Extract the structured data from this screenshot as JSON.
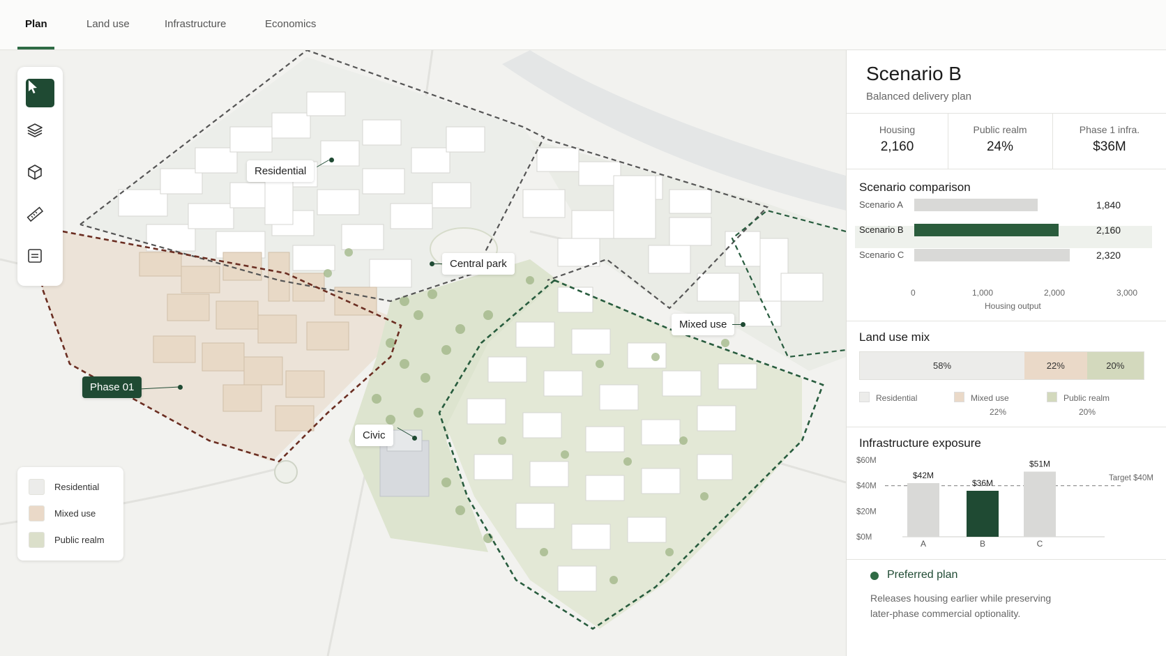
{
  "tabs": [
    {
      "label": "Plan",
      "active": true
    },
    {
      "label": "Land use",
      "active": false
    },
    {
      "label": "Infrastructure",
      "active": false
    },
    {
      "label": "Economics",
      "active": false
    }
  ],
  "toolbar": {
    "tools": [
      "pointer-icon",
      "layers-icon",
      "cube-icon",
      "ruler-icon",
      "list-icon"
    ]
  },
  "map": {
    "labels": {
      "residential": "Residential",
      "central_park": "Central park",
      "mixed_use": "Mixed use",
      "phase": "Phase 01",
      "civic": "Civic"
    },
    "legend": [
      {
        "label": "Residential",
        "color": "#ececea"
      },
      {
        "label": "Mixed use",
        "color": "#ead9c8"
      },
      {
        "label": "Public realm",
        "color": "#dbdfca"
      }
    ]
  },
  "panel": {
    "title": "Scenario B",
    "subtitle": "Balanced delivery plan",
    "kpis": [
      {
        "label": "Housing",
        "value": "2,160"
      },
      {
        "label": "Public realm",
        "value": "24%"
      },
      {
        "label": "Phase 1 infra.",
        "value": "$36M"
      }
    ],
    "comparison": {
      "title": "Scenario comparison",
      "rows": [
        {
          "label": "Scenario A",
          "value": 1840,
          "display": "1,840",
          "selected": false
        },
        {
          "label": "Scenario B",
          "value": 2160,
          "display": "2,160",
          "selected": true
        },
        {
          "label": "Scenario C",
          "value": 2320,
          "display": "2,320",
          "selected": false
        }
      ],
      "ticks": [
        "0",
        "1,000",
        "2,000",
        "3,000"
      ],
      "axis_max": 3000,
      "axis_label": "Housing output"
    },
    "land_use": {
      "title": "Land use mix",
      "segments": [
        {
          "label": "Residential",
          "value": 58,
          "display": "58%",
          "color": "#ececea"
        },
        {
          "label": "Mixed use",
          "value": 22,
          "display": "22%",
          "color": "#ead9c8"
        },
        {
          "label": "Public realm",
          "value": 20,
          "display": "20%",
          "color": "#d3d9bd"
        }
      ],
      "legend": [
        {
          "label": "Residential",
          "sub": ""
        },
        {
          "label": "Mixed use",
          "sub": "22%"
        },
        {
          "label": "Public realm",
          "sub": "20%"
        }
      ]
    },
    "infrastructure": {
      "title": "Infrastructure exposure",
      "target_label": "Target $40M"
    },
    "note": {
      "title": "Preferred plan",
      "text_line1": "Releases housing earlier while preserving",
      "text_line2": "later-phase commercial optionality."
    }
  },
  "colors": {
    "accent": "#1f4a33",
    "accent_bright": "#2f6b45",
    "residential": "#ececea",
    "mixed_use": "#ead9c8",
    "public_realm": "#d3d9bd"
  },
  "chart_data": {
    "type": "bar",
    "title": "Infrastructure exposure",
    "categories": [
      "A",
      "B",
      "C"
    ],
    "values": [
      42,
      36,
      51
    ],
    "value_labels": [
      "$42M",
      "$36M",
      "$51M"
    ],
    "highlight": "B",
    "yticks": [
      "$0M",
      "$20M",
      "$40M",
      "$60M"
    ],
    "ylim": [
      0,
      60
    ],
    "target": 40,
    "target_label": "Target $40M",
    "grid": false
  }
}
